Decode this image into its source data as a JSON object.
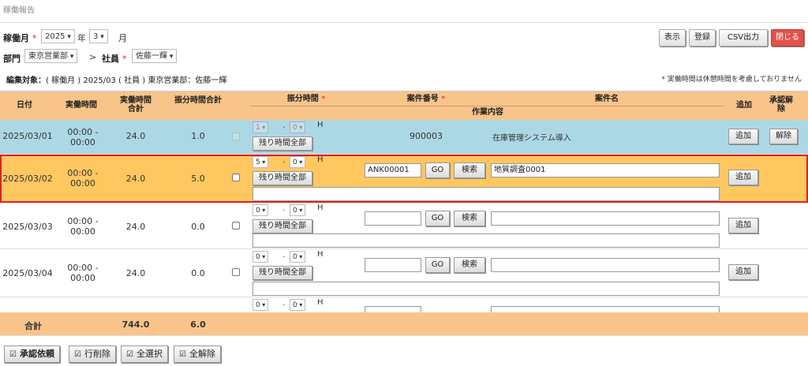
{
  "page_title": "稼働報告",
  "filters": {
    "month_label": "稼働月",
    "required_mark": "*",
    "year_value": "2025",
    "year_unit": "年",
    "month_value": "3",
    "month_unit": "月",
    "dept_label": "部門",
    "dept_value": "東京営業部",
    "arrow": ">",
    "employee_label": "社員",
    "employee_value": "佐藤一輝"
  },
  "toolbar": {
    "show": "表示",
    "register": "登録",
    "csv": "CSV出力",
    "close": "閉じる"
  },
  "target": {
    "label": "編集対象：",
    "text": "( 稼働月 ) 2025/03 ( 社員 ) 東京営業部：佐藤一輝"
  },
  "note": "* 実働時間は休憩時間を考慮しておりません",
  "headers": {
    "date": "日付",
    "actual": "実働時間",
    "actual_total": "実働時間合計",
    "alloc_total": "振分時間合計",
    "alloc_time": "振分時間",
    "alloc_req": "*",
    "case_no": "案件番号",
    "case_req": "*",
    "case_name": "案件名",
    "work_content": "作業内容",
    "add": "追加",
    "approve_cancel": "承認解除"
  },
  "rows": [
    {
      "date": "2025/03/01",
      "actual": "00:00 -\n00:00",
      "actual_total": "24.0",
      "alloc_total": "1.0",
      "hour": "1",
      "minute": "0",
      "unit": "H",
      "remaining": "残り時間全部",
      "case_no": "900003",
      "case_name": "在庫管理システム導入",
      "add": "追加",
      "cancel": "解除"
    },
    {
      "date": "2025/03/02",
      "actual": "00:00 -\n00:00",
      "actual_total": "24.0",
      "alloc_total": "5.0",
      "hour": "5",
      "minute": "0",
      "unit": "H",
      "remaining": "残り時間全部",
      "case_no": "ANK00001",
      "go": "GO",
      "search": "検索",
      "case_name": "地質調査0001",
      "add": "追加"
    },
    {
      "date": "2025/03/03",
      "actual": "00:00 -\n00:00",
      "actual_total": "24.0",
      "alloc_total": "0.0",
      "hour": "0",
      "minute": "0",
      "unit": "H",
      "remaining": "残り時間全部",
      "case_no": "",
      "go": "GO",
      "search": "検索",
      "case_name": "",
      "add": "追加"
    },
    {
      "date": "2025/03/04",
      "actual": "00:00 -\n00:00",
      "actual_total": "24.0",
      "alloc_total": "0.0",
      "hour": "0",
      "minute": "0",
      "unit": "H",
      "remaining": "残り時間全部",
      "case_no": "",
      "go": "GO",
      "search": "検索",
      "case_name": "",
      "add": "追加"
    },
    {
      "hour": "0",
      "minute": "0",
      "unit": "H"
    }
  ],
  "totals": {
    "label": "合計",
    "actual_total": "744.0",
    "alloc_total": "6.0"
  },
  "footer": {
    "approve_request": "承認依頼",
    "delete_row": "行削除",
    "select_all": "全選択",
    "deselect_all": "全解除"
  },
  "colors": {
    "blue_row": "#acd8e6",
    "selected_row": "#ffc760",
    "header": "#f8c48a",
    "close_button": "#e0524b"
  }
}
